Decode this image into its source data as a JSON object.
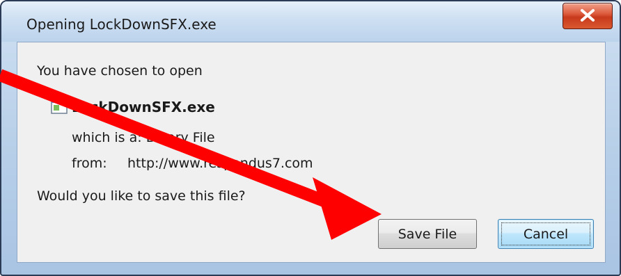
{
  "window": {
    "title": "Opening LockDownSFX.exe",
    "close_label": "X"
  },
  "content": {
    "intro": "You have chosen to open",
    "file_icon": "application-exe-icon",
    "filename": "LockDownSFX.exe",
    "file_type_text": "which is a: Binary File",
    "from_label": "from:",
    "from_url": "http://www.respondus7.com",
    "question": "Would you like to save this file?"
  },
  "buttons": {
    "save_label": "Save File",
    "cancel_label": "Cancel"
  },
  "annotation": {
    "arrow_color": "#ff0000"
  }
}
